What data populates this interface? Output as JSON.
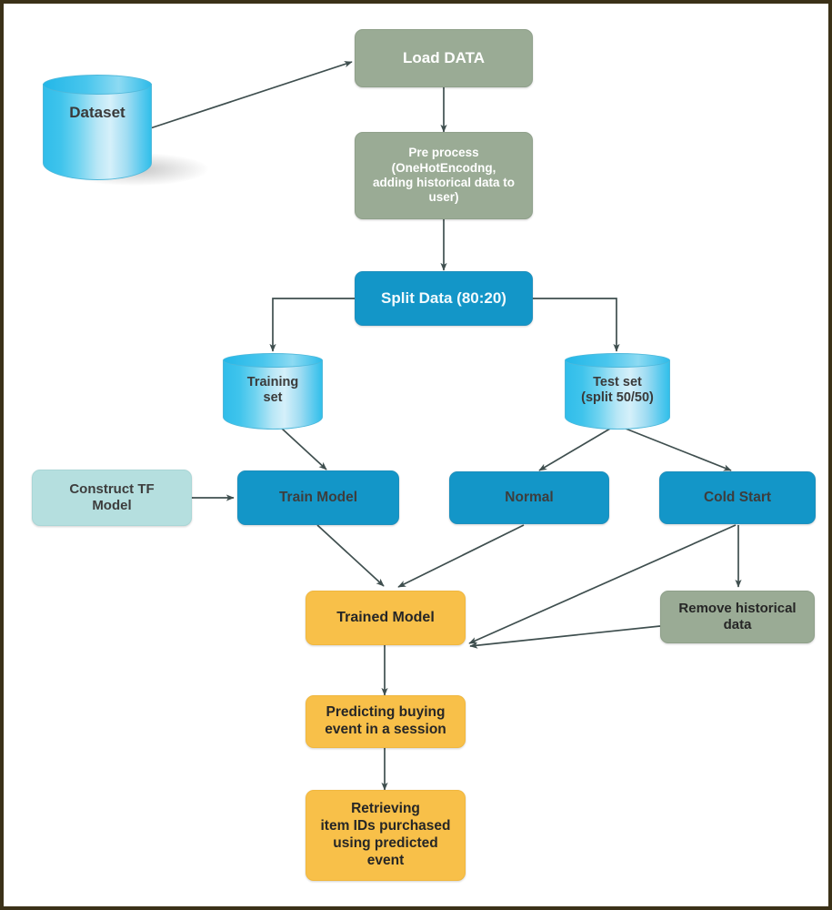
{
  "diagram": {
    "title": "Machine learning recommendation pipeline flowchart",
    "border_color": "#3b3118",
    "background": "#ffffff",
    "palette": {
      "green": "#9aab95",
      "blue": "#1396c8",
      "orange": "#f8c049",
      "cyan": "#b5dfdf",
      "cylinder": "#31bdea",
      "edge": "#3f4f4f"
    }
  },
  "nodes": {
    "dataset": {
      "label": "Dataset",
      "shape": "cylinder"
    },
    "load_data": {
      "label": "Load DATA",
      "shape": "rounded-rect",
      "color": "#9aab95"
    },
    "pre_process": {
      "label": "Pre process\n(OneHotEncodng,\nadding historical data to\nuser)",
      "shape": "rounded-rect",
      "color": "#9aab95"
    },
    "split_data": {
      "label": "Split Data (80:20)",
      "shape": "rounded-rect",
      "color": "#1396c8"
    },
    "training_set": {
      "label": "Training\nset",
      "shape": "cylinder"
    },
    "test_set": {
      "label": "Test set\n(split 50/50)",
      "shape": "cylinder"
    },
    "construct_tf_model": {
      "label": "Construct TF\nModel",
      "shape": "rounded-rect",
      "color": "#b5dfdf"
    },
    "train_model": {
      "label": "Train Model",
      "shape": "rounded-rect",
      "color": "#1396c8"
    },
    "normal": {
      "label": "Normal",
      "shape": "rounded-rect",
      "color": "#1396c8"
    },
    "cold_start": {
      "label": "Cold Start",
      "shape": "rounded-rect",
      "color": "#1396c8"
    },
    "trained_model": {
      "label": "Trained Model",
      "shape": "rounded-rect",
      "color": "#f8c049"
    },
    "remove_historical_data": {
      "label": "Remove historical\ndata",
      "shape": "rounded-rect",
      "color": "#9aab95"
    },
    "predicting_buying_event": {
      "label": "Predicting buying\nevent in a session",
      "shape": "rounded-rect",
      "color": "#f8c049"
    },
    "retrieving_item_ids": {
      "label": "Retrieving\nitem IDs purchased\nusing predicted\nevent",
      "shape": "rounded-rect",
      "color": "#f8c049"
    }
  },
  "edges": [
    {
      "from": "dataset",
      "to": "load_data",
      "style": "diagonal"
    },
    {
      "from": "load_data",
      "to": "pre_process",
      "style": "vertical"
    },
    {
      "from": "pre_process",
      "to": "split_data",
      "style": "vertical"
    },
    {
      "from": "split_data",
      "to": "training_set",
      "style": "elbow-left"
    },
    {
      "from": "split_data",
      "to": "test_set",
      "style": "elbow-right"
    },
    {
      "from": "training_set",
      "to": "train_model",
      "style": "diagonal"
    },
    {
      "from": "construct_tf_model",
      "to": "train_model",
      "style": "horizontal"
    },
    {
      "from": "test_set",
      "to": "normal",
      "style": "diagonal"
    },
    {
      "from": "test_set",
      "to": "cold_start",
      "style": "diagonal"
    },
    {
      "from": "train_model",
      "to": "trained_model",
      "style": "diagonal"
    },
    {
      "from": "normal",
      "to": "trained_model",
      "style": "diagonal"
    },
    {
      "from": "cold_start",
      "to": "remove_historical_data",
      "style": "vertical"
    },
    {
      "from": "cold_start",
      "to": "trained_model",
      "style": "diagonal"
    },
    {
      "from": "remove_historical_data",
      "to": "trained_model",
      "style": "diagonal"
    },
    {
      "from": "trained_model",
      "to": "predicting_buying_event",
      "style": "vertical"
    },
    {
      "from": "predicting_buying_event",
      "to": "retrieving_item_ids",
      "style": "vertical"
    }
  ]
}
